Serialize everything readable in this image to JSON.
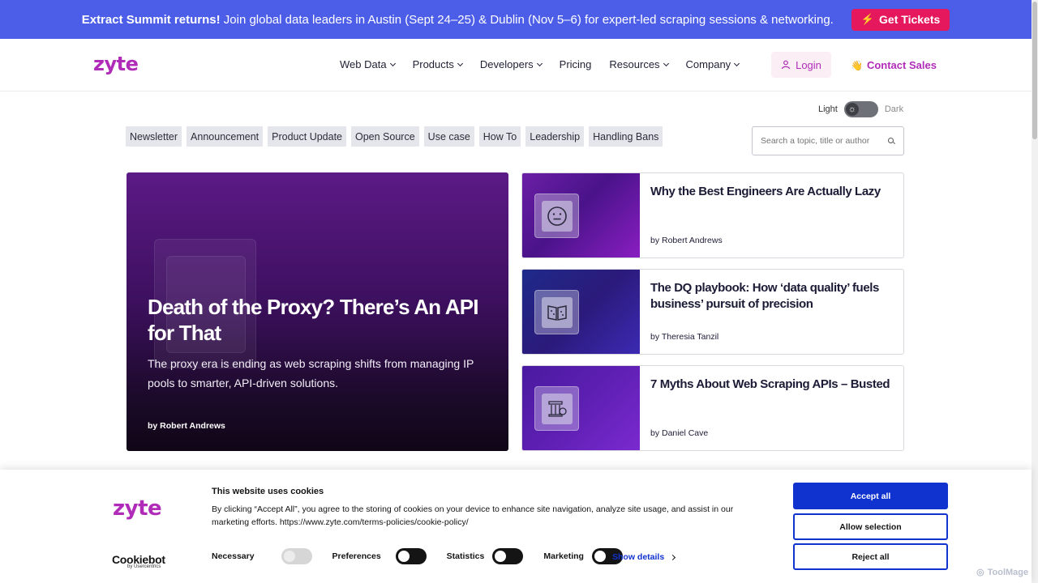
{
  "announcement": {
    "bold": "Extract Summit returns!",
    "text": "Join global data leaders in Austin (Sept 24–25) & Dublin (Nov 5–6) for expert-led scraping sessions & networking.",
    "cta": "Get Tickets",
    "cta_icon": "lightning-bolt-icon",
    "background": "#4c5ee8",
    "cta_color": "#e5185d"
  },
  "header": {
    "logo": "zyte",
    "nav": [
      {
        "label": "Web Data",
        "dropdown": true
      },
      {
        "label": "Products",
        "dropdown": true
      },
      {
        "label": "Developers",
        "dropdown": true
      },
      {
        "label": "Pricing",
        "dropdown": false
      },
      {
        "label": "Resources",
        "dropdown": true
      },
      {
        "label": "Company",
        "dropdown": true
      }
    ],
    "login": "Login",
    "contact": "Contact Sales",
    "brand_color": "#b02cb8"
  },
  "theme_toggle": {
    "light": "Light",
    "dark": "Dark",
    "state": "light"
  },
  "tags": [
    "Newsletter",
    "Announcement",
    "Product Update",
    "Open Source",
    "Use case",
    "How To",
    "Leadership",
    "Handling Bans"
  ],
  "search": {
    "placeholder": "Search a topic, title or author"
  },
  "featured": {
    "title": "Death of the Proxy? There’s An API for That",
    "description": "The proxy era is ending as web scraping shifts from managing IP pools to smarter, API-driven solutions.",
    "author": "by Robert Andrews"
  },
  "articles": [
    {
      "title": "Why the Best Engineers Are Actually Lazy",
      "author": "by Robert Andrews",
      "icon": "neutral-face-icon"
    },
    {
      "title": "The DQ playbook: How ‘data quality’ fuels business’ pursuit of precision",
      "author": "by Theresia Tanzil",
      "icon": "book-icon"
    },
    {
      "title": "7 Myths About Web Scraping APIs – Busted",
      "author": "by Daniel Cave",
      "icon": "column-icon"
    }
  ],
  "cookie": {
    "logo": "zyte",
    "title": "This website uses cookies",
    "text": "By clicking “Accept All”, you agree to the storing of cookies on your device to enhance site navigation, analyze site usage, and assist in our marketing efforts. https://www.zyte.com/terms-policies/cookie-policy/",
    "consents": [
      {
        "label": "Necessary",
        "state": "disabled"
      },
      {
        "label": "Preferences",
        "state": "on"
      },
      {
        "label": "Statistics",
        "state": "on"
      },
      {
        "label": "Marketing",
        "state": "on"
      }
    ],
    "show_details": "Show details",
    "accept_all": "Accept all",
    "allow_selection": "Allow selection",
    "reject_all": "Reject all",
    "cookiebot": "Cookiebot",
    "cookiebot_sub": "by Usercentrics",
    "button_color": "#1032cf"
  },
  "watermark": "ToolMage"
}
